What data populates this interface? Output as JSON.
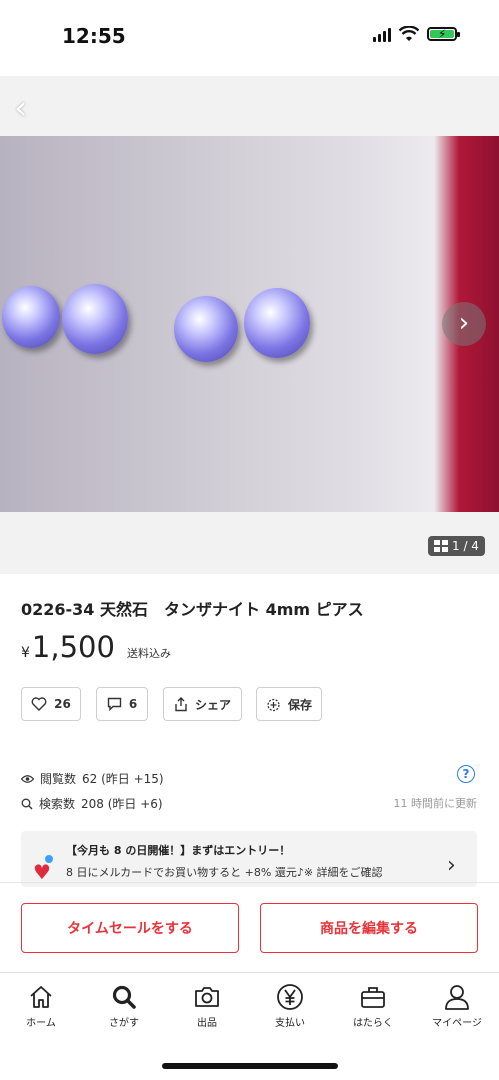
{
  "status": {
    "time": "12:55"
  },
  "photo": {
    "counter": "1 / 4"
  },
  "product": {
    "title": "0226-34 天然石　タンザナイト 4mm ピアス",
    "currency": "¥",
    "price": "1,500",
    "shipping": "送料込み"
  },
  "actions": {
    "likes": "26",
    "comments": "6",
    "share": "シェア",
    "save": "保存"
  },
  "stats": {
    "views_label": "閲覧数",
    "views_value": "62 (昨日 +15)",
    "search_label": "検索数",
    "search_value": "208 (昨日 +6)",
    "help": "?",
    "updated": "11 時間前に更新"
  },
  "banner": {
    "line1": "【今月も 8 の日開催！】まずはエントリー！",
    "line2": "8 日にメルカードでお買い物すると +8% 還元♪※ 詳細をご確認"
  },
  "cta": {
    "timesale": "タイムセールをする",
    "edit": "商品を編集する"
  },
  "nav": [
    {
      "label": "ホーム",
      "icon": "home-icon"
    },
    {
      "label": "さがす",
      "icon": "search-icon"
    },
    {
      "label": "出品",
      "icon": "camera-icon"
    },
    {
      "label": "支払い",
      "icon": "yen-icon"
    },
    {
      "label": "はたらく",
      "icon": "briefcase-icon"
    },
    {
      "label": "マイページ",
      "icon": "person-icon"
    }
  ],
  "colors": {
    "accent": "#e6343a",
    "link": "#2b7de9",
    "battery": "#34c759"
  }
}
